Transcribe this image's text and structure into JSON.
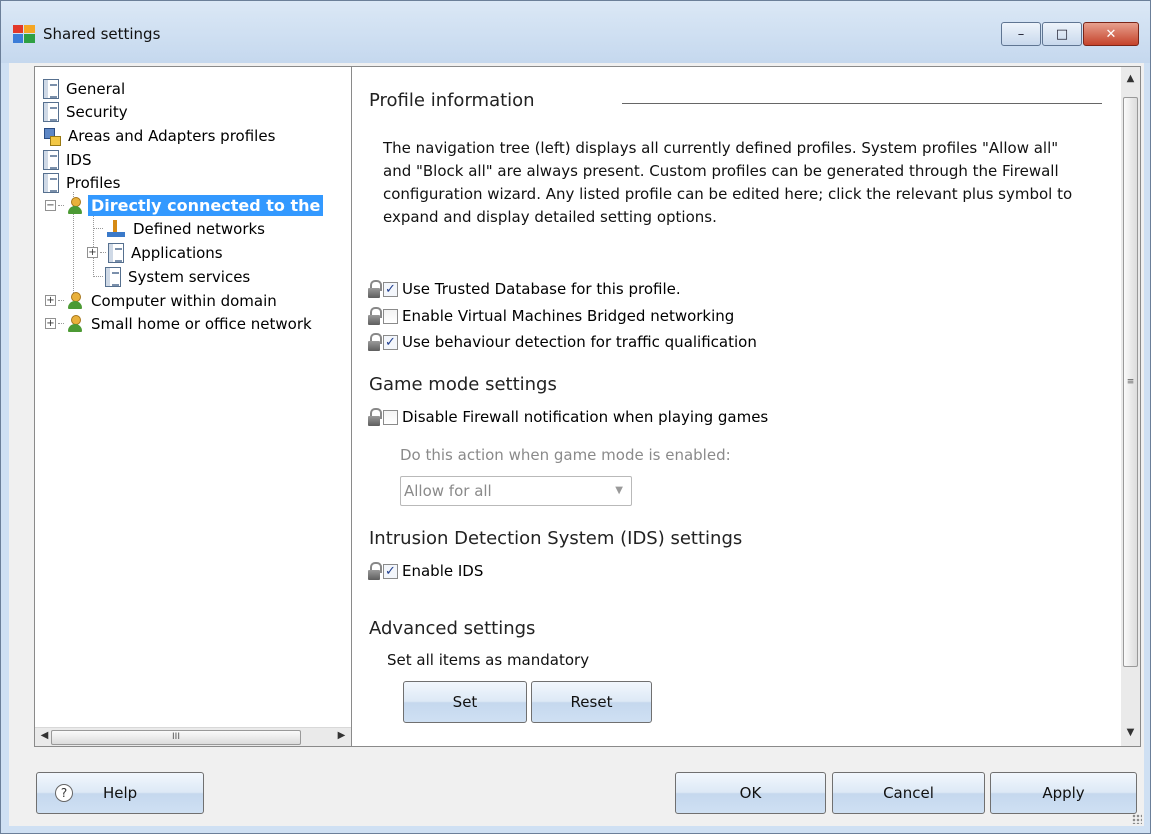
{
  "window": {
    "title": "Shared settings",
    "controls": {
      "minimize": "–",
      "maximize": "□",
      "close": "✕"
    }
  },
  "tree": {
    "items": [
      {
        "label": "General",
        "icon": "document-icon",
        "level": 0
      },
      {
        "label": "Security",
        "icon": "document-icon",
        "level": 0
      },
      {
        "label": "Areas and Adapters profiles",
        "icon": "network-icon",
        "level": 0
      },
      {
        "label": "IDS",
        "icon": "document-icon",
        "level": 0
      },
      {
        "label": "Profiles",
        "icon": "document-icon",
        "level": 0
      },
      {
        "label": "Directly connected to the",
        "icon": "user-icon",
        "level": 1,
        "expander": "⊟",
        "selected": true
      },
      {
        "label": "Defined networks",
        "icon": "defined-network-icon",
        "level": 2
      },
      {
        "label": "Applications",
        "icon": "document-icon",
        "level": 2,
        "expander": "⊞"
      },
      {
        "label": "System services",
        "icon": "document-icon",
        "level": 2
      },
      {
        "label": "Computer within domain",
        "icon": "user-icon",
        "level": 1,
        "expander": "⊞"
      },
      {
        "label": "Small home or office network",
        "icon": "user-icon",
        "level": 1,
        "expander": "⊞"
      }
    ],
    "scrollbar": {
      "left": "◀",
      "right": "▶",
      "grip": "III"
    }
  },
  "content": {
    "profile_section": {
      "title": "Profile information",
      "description": "The navigation tree (left) displays all currently defined profiles. System profiles \"Allow all\" and \"Block all\" are always present. Custom profiles can be generated through the Firewall configuration wizard. Any listed profile can be edited here; click the relevant plus symbol to expand and display detailed setting options."
    },
    "options": [
      {
        "label": "Use Trusted Database for this profile.",
        "checked": true
      },
      {
        "label": "Enable Virtual Machines Bridged networking",
        "checked": false
      },
      {
        "label": "Use behaviour detection for traffic qualification",
        "checked": true
      }
    ],
    "game_mode": {
      "title": "Game mode settings",
      "option": {
        "label": "Disable Firewall notification when playing games",
        "checked": false
      },
      "action_label": "Do this action when game mode is enabled:",
      "action_value": "Allow for all"
    },
    "ids": {
      "title": "Intrusion Detection System (IDS) settings",
      "option": {
        "label": "Enable IDS",
        "checked": true
      }
    },
    "advanced": {
      "title": "Advanced settings",
      "description": "Set all items as mandatory",
      "set_label": "Set",
      "reset_label": "Reset"
    },
    "scrollbar": {
      "up": "▲",
      "down": "▼",
      "grip": "≡"
    }
  },
  "footer": {
    "help_label": "Help",
    "ok_label": "OK",
    "cancel_label": "Cancel",
    "apply_label": "Apply"
  },
  "check_mark": "✓"
}
